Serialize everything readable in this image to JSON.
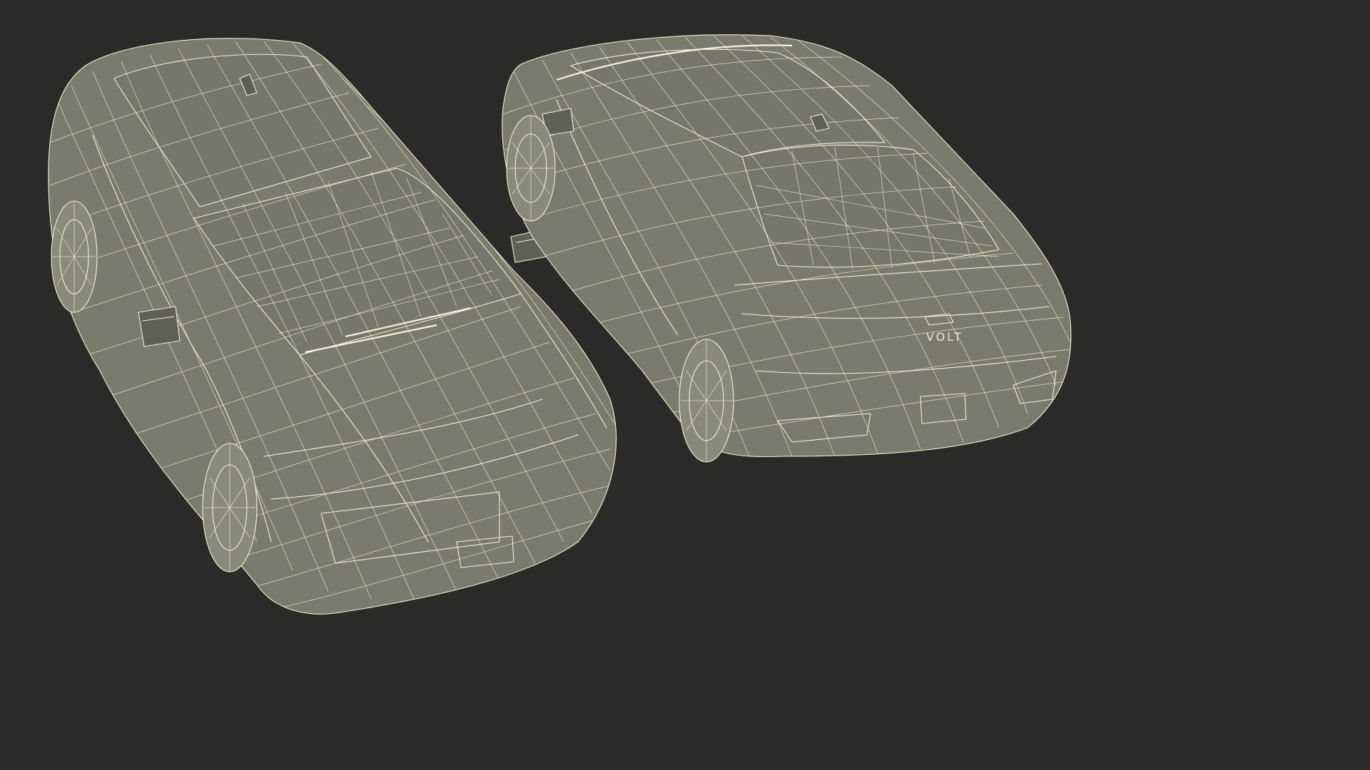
{
  "scene": {
    "background_color": "#2a2a28",
    "body_color": "#7b7b6d",
    "wire_color": "#f2f0d2"
  },
  "models": [
    {
      "view": "front-three-quarter"
    },
    {
      "view": "rear-three-quarter",
      "badge_text": "VOLT"
    }
  ]
}
